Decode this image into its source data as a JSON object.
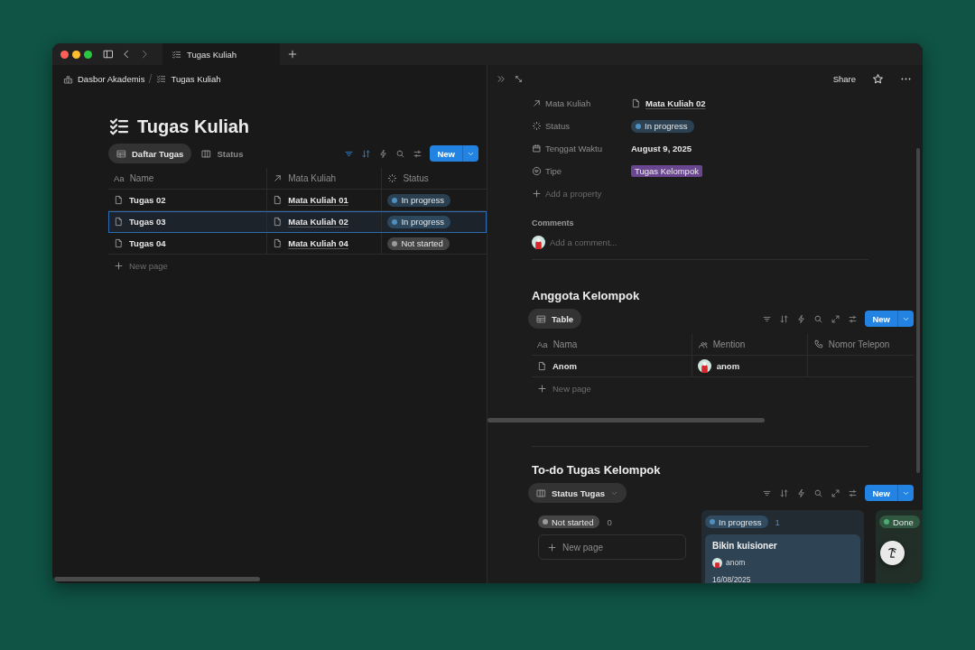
{
  "window": {
    "tab_title": "Tugas Kuliah"
  },
  "breadcrumb": [
    {
      "label": "Dasbor Akademis",
      "kind": "dashboard"
    },
    {
      "label": "Tugas Kuliah",
      "kind": "checklist"
    }
  ],
  "page": {
    "title": "Tugas Kuliah",
    "views": [
      {
        "label": "Daftar Tugas",
        "kind": "table",
        "selected": true
      },
      {
        "label": "Status",
        "kind": "board",
        "selected": false
      }
    ],
    "filter_active": true,
    "sort_active": true,
    "new_button": "New",
    "columns": [
      {
        "label": "Name",
        "kind": "title",
        "prefix": "Aa"
      },
      {
        "label": "Mata Kuliah",
        "kind": "relation"
      },
      {
        "label": "Status",
        "kind": "status"
      }
    ],
    "rows": [
      {
        "name": "Tugas 02",
        "course": "Mata Kuliah 01",
        "status": {
          "label": "In progress",
          "color": "#4f8fc0"
        },
        "selected": false
      },
      {
        "name": "Tugas 03",
        "course": "Mata Kuliah 02",
        "status": {
          "label": "In progress",
          "color": "#4f8fc0"
        },
        "selected": true
      },
      {
        "name": "Tugas 04",
        "course": "Mata Kuliah 04",
        "status": {
          "label": "Not started",
          "color": "#9b9b9b"
        },
        "selected": false
      }
    ],
    "new_row": "New page"
  },
  "detail": {
    "share": "Share",
    "properties": [
      {
        "label": "Mata Kuliah",
        "kind": "relation",
        "value": "Mata Kuliah 02"
      },
      {
        "label": "Status",
        "kind": "status",
        "value": "In progress",
        "color": "#4f8fc0"
      },
      {
        "label": "Tenggat Waktu",
        "kind": "date",
        "value": "August 9, 2025"
      },
      {
        "label": "Tipe",
        "kind": "select",
        "value": "Tugas Kelompok",
        "color": "#6a4590"
      }
    ],
    "add_property": "Add a property",
    "comments": {
      "heading": "Comments",
      "placeholder": "Add a comment..."
    }
  },
  "members": {
    "title": "Anggota Kelompok",
    "views": [
      {
        "label": "Table",
        "kind": "table",
        "selected": true
      }
    ],
    "new_button": "New",
    "columns": [
      {
        "label": "Nama",
        "kind": "title",
        "prefix": "Aa"
      },
      {
        "label": "Mention",
        "kind": "person"
      },
      {
        "label": "Nomor Telepon",
        "kind": "phone"
      }
    ],
    "rows": [
      {
        "name": "Anom",
        "mention": "anom"
      }
    ],
    "new_row": "New page"
  },
  "todo": {
    "title": "To-do Tugas Kelompok",
    "view": {
      "label": "Status Tugas",
      "kind": "board"
    },
    "new_button": "New",
    "groups": [
      {
        "label": "Not started",
        "color": "#9b9b9b",
        "count": "0",
        "tinted": false,
        "new_page": "New page"
      },
      {
        "label": "In progress",
        "color": "#4f8fc0",
        "count": "1",
        "tinted": true,
        "cards": [
          {
            "title": "Bikin kuisioner",
            "person": "anom",
            "date": "16/08/2025"
          }
        ]
      },
      {
        "label": "Done",
        "color": "#4dab75",
        "tinted": true
      }
    ]
  }
}
